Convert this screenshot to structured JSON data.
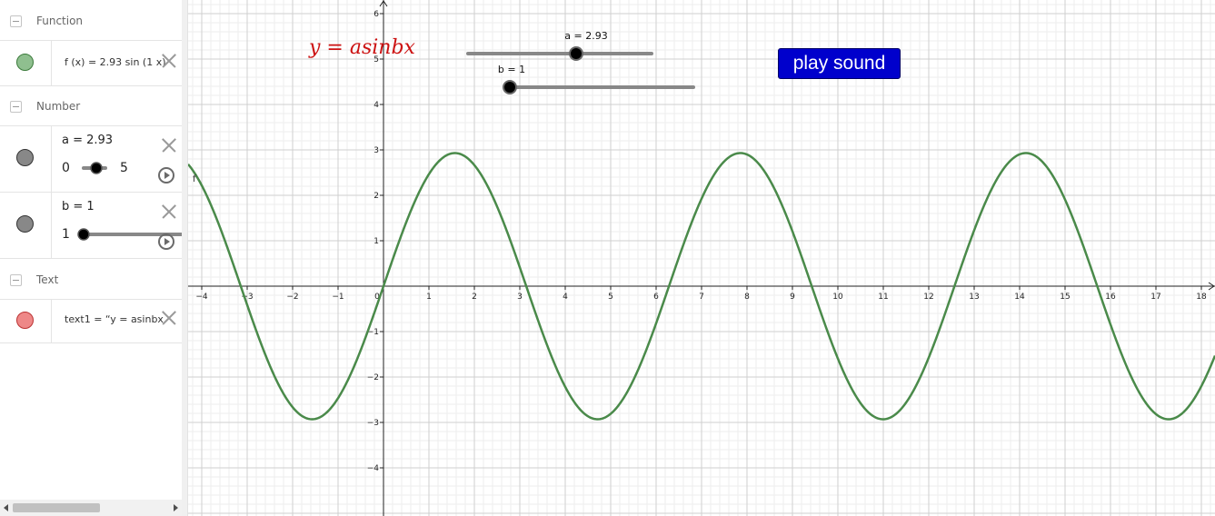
{
  "algebra": {
    "categories": {
      "function": "Function",
      "number": "Number",
      "text": "Text"
    },
    "f": {
      "definition": "f (x)  =  2.93  sin (1 x)",
      "color": "#8fbf8f"
    },
    "a": {
      "label": "a = 2.93",
      "min": "0",
      "max": "5",
      "value": 2.93,
      "color": "#888888"
    },
    "b": {
      "label": "b = 1",
      "min": "1",
      "value": 1,
      "color": "#888888"
    },
    "text1": {
      "definition": "text1  =  “y = asinbx",
      "color": "#ee8888"
    }
  },
  "graphics": {
    "formula_text": "y = asinbx",
    "formula_color": "#cc1111",
    "button_label": "play sound",
    "button_color": "#0000cc",
    "slider_a_label": "a = 2.93",
    "slider_b_label": "b = 1",
    "curve_label": "f",
    "curve_color": "#4a8a4a"
  },
  "chart_data": {
    "type": "line",
    "xlim": [
      -4.3,
      18.2
    ],
    "ylim": [
      -5,
      6.2
    ],
    "x_ticks": [
      "−4",
      "−3",
      "−2",
      "−1",
      "0",
      "1",
      "2",
      "3",
      "4",
      "5",
      "6",
      "7",
      "8",
      "9",
      "10",
      "11",
      "12",
      "13",
      "14",
      "15",
      "16",
      "17",
      "18"
    ],
    "y_ticks": [
      "−4",
      "−3",
      "−2",
      "−1",
      "1",
      "2",
      "3",
      "4",
      "5",
      "6"
    ],
    "grid": true,
    "series": [
      {
        "name": "f",
        "function": "2.93 sin(x)",
        "amplitude": 2.93,
        "frequency": 1
      }
    ]
  }
}
